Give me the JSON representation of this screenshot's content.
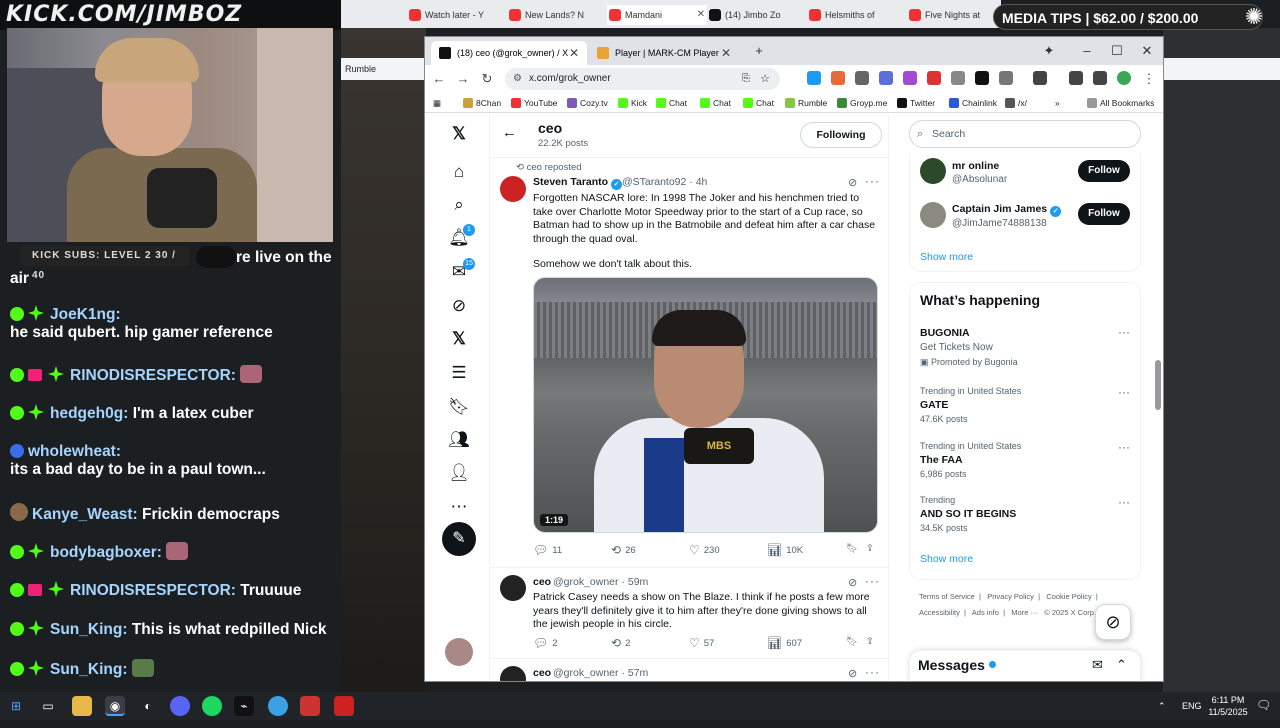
{
  "stream": {
    "banner_text": "KICK.COM/JIMBOZ",
    "media_tips": "MEDIA TIPS | $62.00 / $200.00",
    "kick_subs": "KICK SUBS: LEVEL 2 30 / 40",
    "chat": [
      {
        "user": "",
        "text": "re live on the",
        "text2": "air",
        "badges": "none"
      },
      {
        "user": "JoeK1ng:",
        "text": "he said qubert. hip gamer reference",
        "badges": "kick-star"
      },
      {
        "user": "RINODISRESPECTOR:",
        "text": "",
        "badges": "kick-gift-star",
        "emote": true
      },
      {
        "user": "hedgeh0g:",
        "text": "I'm a latex cuber",
        "badges": "kick-star"
      },
      {
        "user": "wholewheat:",
        "text": "its a bad day to be in a paul town...",
        "badges": "blue"
      },
      {
        "user": "Kanye_Weast:",
        "text": "Frickin democraps",
        "badges": "avatar"
      },
      {
        "user": "bodybagboxer:",
        "text": "",
        "badges": "kick-star",
        "emote": true
      },
      {
        "user": "RINODISRESPECTOR:",
        "text": "Truuuue",
        "badges": "kick-gift-star"
      },
      {
        "user": "Sun_King:",
        "text": "This is what redpilled Nick",
        "badges": "kick-star"
      },
      {
        "user": "Sun_King:",
        "text": "",
        "badges": "kick-star",
        "emote": true
      }
    ]
  },
  "bg_browser": {
    "tabs": [
      "Watch later - Y",
      "New Lands? N",
      "Mamdani",
      "(14) Jimbo Zo",
      "Helsmiths of",
      "Five Nights at"
    ],
    "bookmark_left": "Rumble",
    "bookmark_right": "All Bookmarks"
  },
  "browser": {
    "tabs": [
      {
        "title": "(18) ceo (@grok_owner) / X",
        "active": true
      },
      {
        "title": "Player | MARK-CM Player",
        "active": false
      }
    ],
    "url": "x.com/grok_owner",
    "bookmarks": [
      "8Chan",
      "YouTube",
      "Cozy.tv",
      "Kick",
      "Chat",
      "Chat",
      "Chat",
      "Rumble",
      "Groyp.me",
      "Twitter",
      "Chainlink",
      "/x/"
    ],
    "all_bookmarks": "All Bookmarks"
  },
  "x": {
    "nav_badges": {
      "notifications": "1",
      "messages": "15"
    },
    "header": {
      "title": "ceo",
      "posts": "22.2K posts",
      "following": "Following"
    },
    "post1": {
      "reposted": "ceo reposted",
      "name": "Steven Taranto",
      "handle": "@STaranto92 · 4h",
      "text": "Forgotten NASCAR lore: In 1998 The Joker and his henchmen tried to take over Charlotte Motor Speedway prior to the start of a Cup race, so Batman had to show up in the Batmobile and defeat him after a car chase through the quad oval.",
      "text2": "Somehow we don't talk about this.",
      "duration": "1:19",
      "mic_text": "MBS",
      "replies": "11",
      "reposts": "26",
      "likes": "230",
      "views": "10K"
    },
    "post2": {
      "name": "ceo",
      "handle": "@grok_owner · 59m",
      "text": "Patrick Casey needs a show on The Blaze. I think if he posts a few more years they'll definitely give it to him after they're done giving shows to all the jewish people in his circle.",
      "replies": "2",
      "reposts": "2",
      "likes": "57",
      "views": "607"
    },
    "post3": {
      "name": "ceo",
      "handle": "@grok_owner · 57m"
    },
    "search_placeholder": "Search",
    "who_to_follow": [
      {
        "name": "mr online",
        "handle": "@Absolunar",
        "button": "Follow"
      },
      {
        "name": "Captain Jim James",
        "handle": "@JimJame74888138",
        "button": "Follow"
      }
    ],
    "show_more": "Show more",
    "whats_happening": "What’s happening",
    "trends": [
      {
        "context": "",
        "title": "BUGONIA",
        "sub": "Get Tickets Now",
        "posts": "Promoted by Bugonia"
      },
      {
        "context": "Trending in United States",
        "title": "GATE",
        "posts": "47.6K posts"
      },
      {
        "context": "Trending in United States",
        "title": "The FAA",
        "posts": "6,986 posts"
      },
      {
        "context": "Trending",
        "title": "AND SO IT BEGINS",
        "posts": "34.5K posts"
      }
    ],
    "show_more2": "Show more",
    "footer1": [
      "Terms of Service",
      "Privacy Policy",
      "Cookie Policy"
    ],
    "footer2": [
      "Accessibility",
      "Ads info",
      "More ···",
      "© 2025 X Corp."
    ],
    "messages": "Messages"
  },
  "taskbar": {
    "lang": "ENG",
    "time": "6:11 PM",
    "date": "11/5/2025"
  }
}
